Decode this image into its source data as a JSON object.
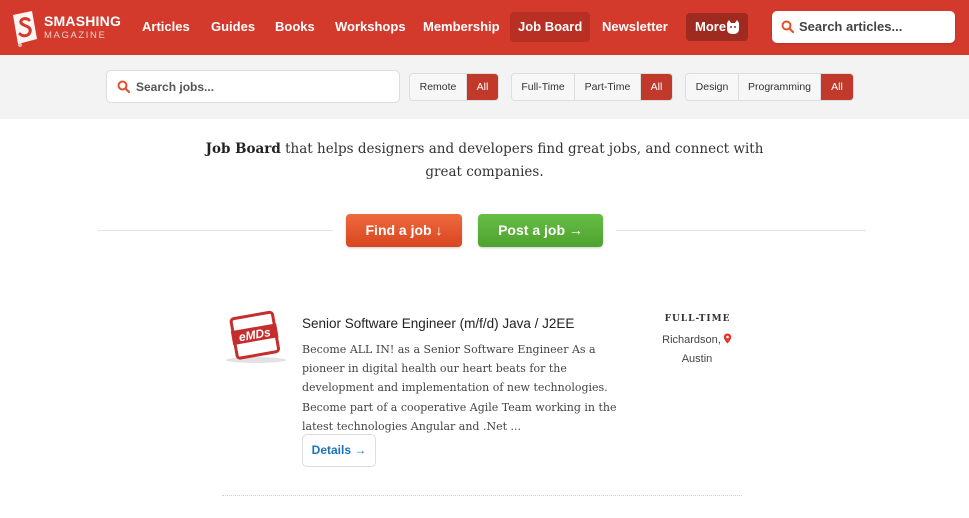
{
  "brand": {
    "name": "SMASHING",
    "tagline": "MAGAZINE"
  },
  "nav": {
    "items": [
      "Articles",
      "Guides",
      "Books",
      "Workshops",
      "Membership",
      "Job Board",
      "Newsletter"
    ],
    "active": "Job Board",
    "more_label": "More",
    "search_placeholder": "Search articles..."
  },
  "filters": {
    "search_placeholder": "Search jobs...",
    "location": [
      "Remote",
      "All"
    ],
    "type": [
      "Full-Time",
      "Part-Time",
      "All"
    ],
    "category": [
      "Design",
      "Programming",
      "All"
    ],
    "active_color": "#c0392b"
  },
  "intro": {
    "bold": "Job Board",
    "rest": " that helps designers and developers find great jobs, and connect with great companies."
  },
  "cta": {
    "find": "Find a job ↓",
    "post": "Post a job →"
  },
  "job": {
    "logo_text": "eMDs",
    "title": "Senior Software Engineer (m/f/d) Java / J2EE",
    "description": "Become ALL IN! as a Senior Software Engineer As a pioneer in digital health our heart beats for the development and implementation of new technologies. Become part of a cooperative Agile Team working in the latest technologies Angular and .Net ...",
    "type": "FULL-TIME",
    "city": "Richardson,",
    "region": "Austin",
    "details_label": "Details →"
  },
  "colors": {
    "brand_red": "#d33a2c",
    "find": "#e2512c",
    "post": "#56ad36",
    "link": "#1a73b8"
  }
}
